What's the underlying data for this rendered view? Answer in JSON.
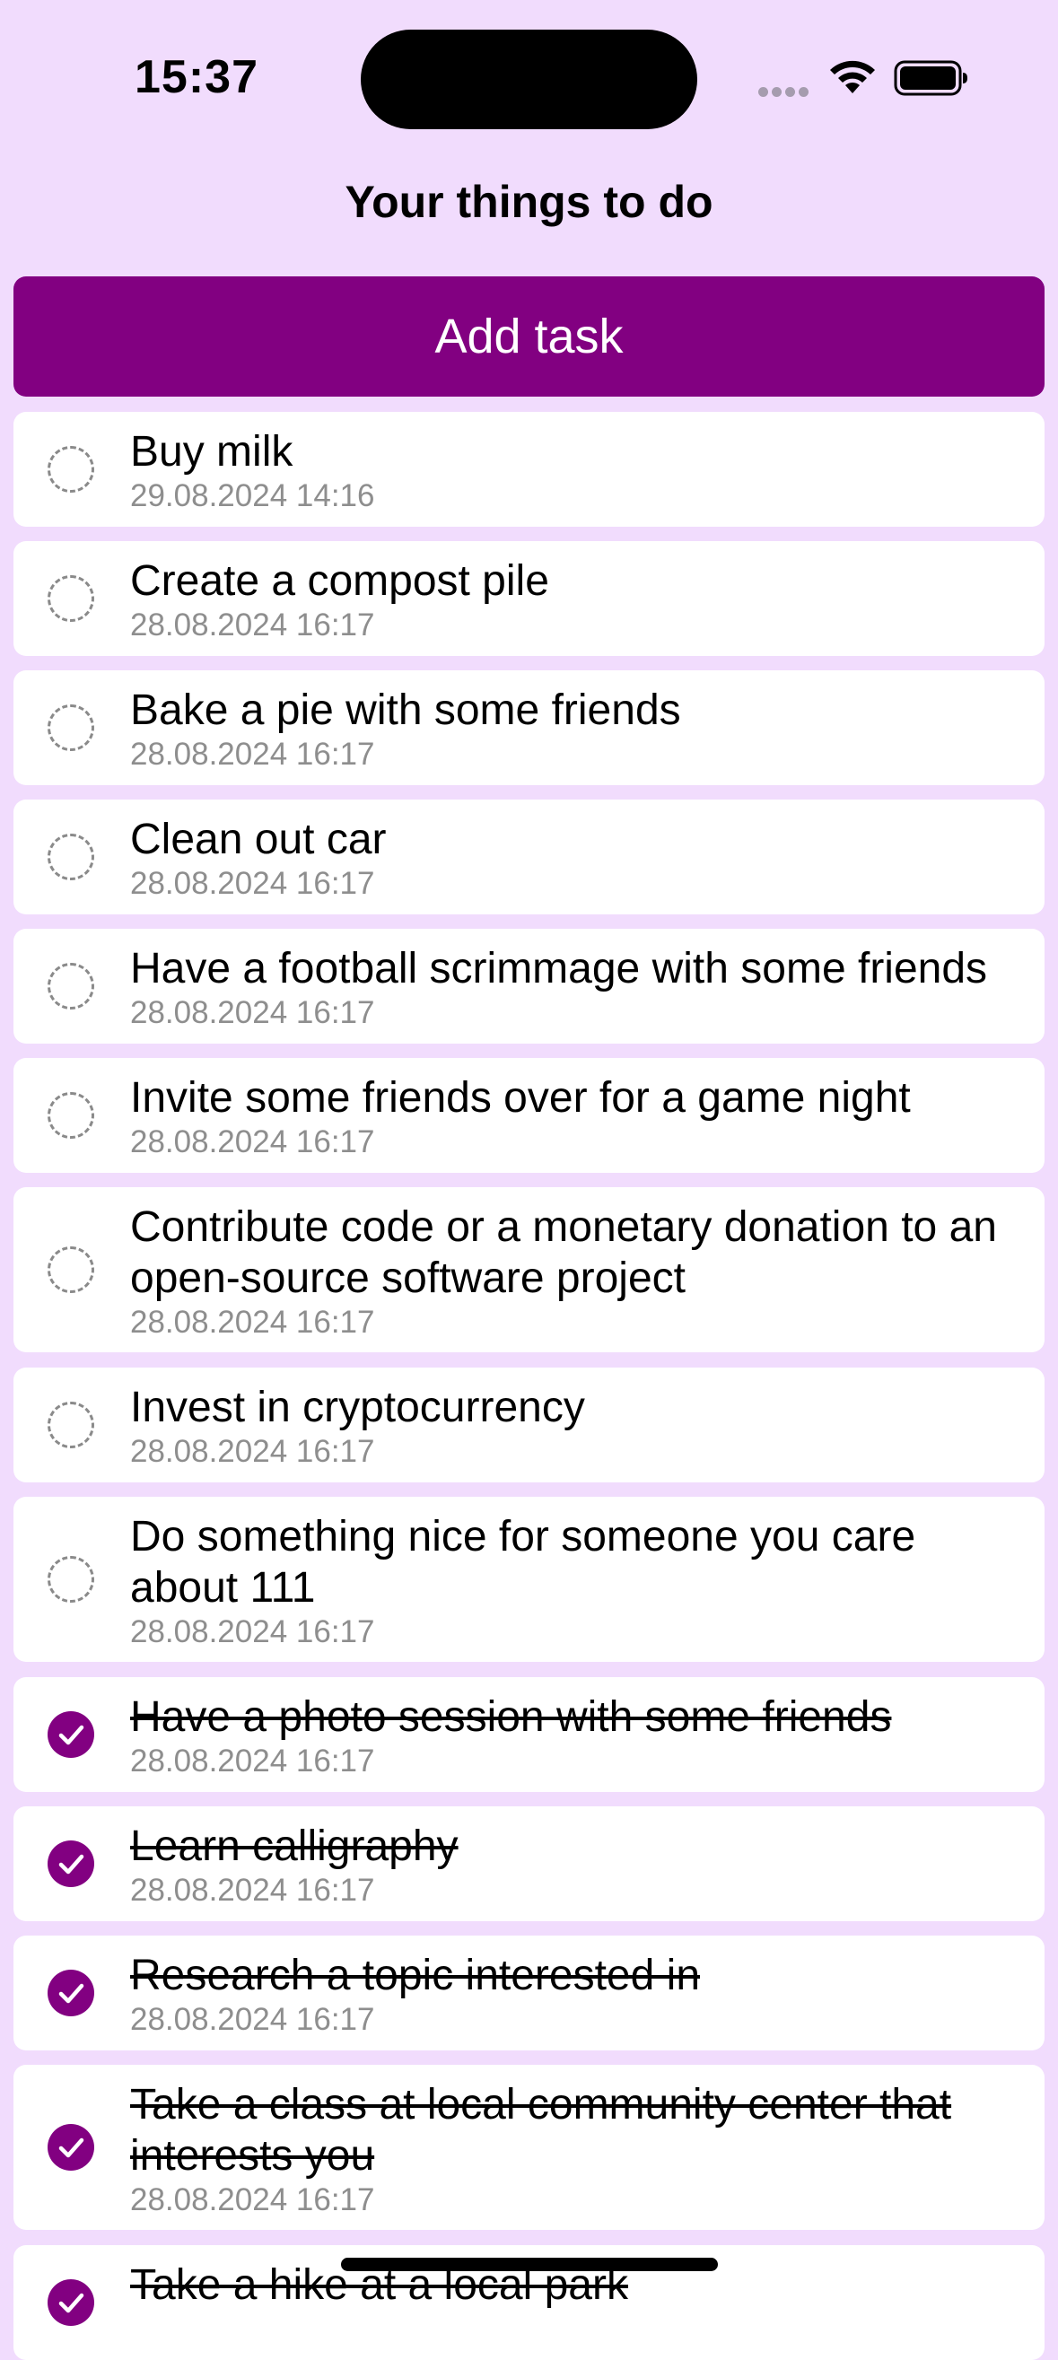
{
  "status_bar": {
    "time": "15:37"
  },
  "header": {
    "title": "Your things to do"
  },
  "add_task_label": "Add task",
  "tasks": [
    {
      "title": "Buy milk",
      "date": "29.08.2024 14:16",
      "done": false
    },
    {
      "title": "Create a compost pile",
      "date": "28.08.2024 16:17",
      "done": false
    },
    {
      "title": "Bake a pie with some friends",
      "date": "28.08.2024 16:17",
      "done": false
    },
    {
      "title": "Clean out car",
      "date": "28.08.2024 16:17",
      "done": false
    },
    {
      "title": "Have a football scrimmage with some friends",
      "date": "28.08.2024 16:17",
      "done": false
    },
    {
      "title": "Invite some friends over for a game night",
      "date": "28.08.2024 16:17",
      "done": false
    },
    {
      "title": "Contribute code or a monetary donation to an open-source software project",
      "date": "28.08.2024 16:17",
      "done": false
    },
    {
      "title": "Invest in cryptocurrency",
      "date": "28.08.2024 16:17",
      "done": false
    },
    {
      "title": "Do something nice for someone you care about 111",
      "date": "28.08.2024 16:17",
      "done": false
    },
    {
      "title": "Have a photo session with some friends",
      "date": "28.08.2024 16:17",
      "done": true
    },
    {
      "title": "Learn calligraphy",
      "date": "28.08.2024 16:17",
      "done": true
    },
    {
      "title": "Research a topic interested in",
      "date": "28.08.2024 16:17",
      "done": true
    },
    {
      "title": "Take a class at local community center that interests you",
      "date": "28.08.2024 16:17",
      "done": true
    },
    {
      "title": "Take a hike at a local park",
      "date": "",
      "done": true
    }
  ],
  "colors": {
    "background": "#f1dcfd",
    "accent": "#820081",
    "card": "#ffffff",
    "date_text": "#8e8e8e"
  },
  "icons": {
    "wifi": "wifi-icon",
    "battery": "battery-icon",
    "open_task": "dashed-circle-icon",
    "done_task": "checkmark-circle-icon"
  }
}
